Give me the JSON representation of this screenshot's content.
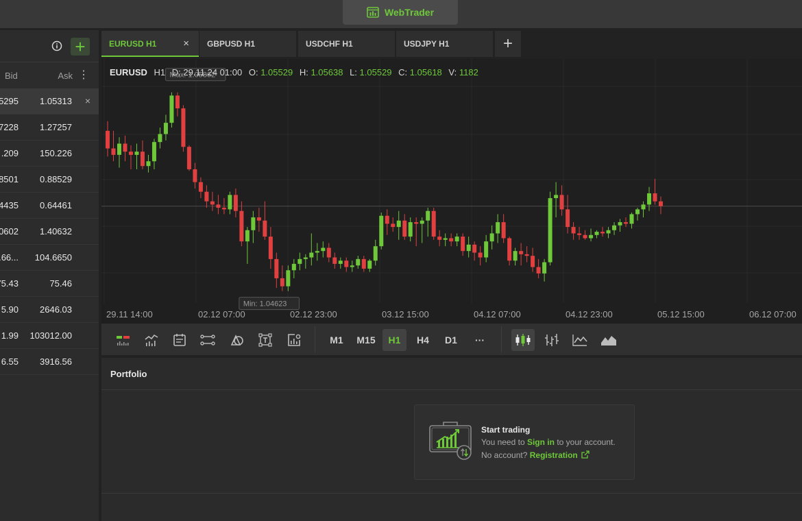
{
  "header": {
    "brand": "WebTrader",
    "brand_icon": "chart-window-icon"
  },
  "watchlist": {
    "bid_header": "Bid",
    "ask_header": "Ask",
    "rows": [
      {
        "bid": "5295",
        "ask": "1.05313",
        "selected": true
      },
      {
        "bid": "7228",
        "ask": "1.27257"
      },
      {
        "bid": ".209",
        "ask": "150.226"
      },
      {
        "bid": "8501",
        "ask": "0.88529"
      },
      {
        "bid": "4435",
        "ask": "0.64461"
      },
      {
        "bid": "0602",
        "ask": "1.40632"
      },
      {
        "bid": ".66...",
        "ask": "104.6650"
      },
      {
        "bid": "75.43",
        "ask": "75.46"
      },
      {
        "bid": "5.90",
        "ask": "2646.03"
      },
      {
        "bid": "1.99",
        "ask": "103012.00"
      },
      {
        "bid": "6.55",
        "ask": "3916.56"
      }
    ]
  },
  "tabs": [
    {
      "label": "EURUSD H1",
      "active": true
    },
    {
      "label": "GBPUSD H1"
    },
    {
      "label": "USDCHF H1"
    },
    {
      "label": "USDJPY H1"
    }
  ],
  "chart_info": {
    "symbol": "EURUSD",
    "timeframe": "H1",
    "d_label": "D:",
    "d_value": "29.11.24 01:00",
    "o_label": "O:",
    "o_value": "1.05529",
    "h_label": "H:",
    "h_value": "1.05638",
    "l_label": "L:",
    "l_value": "1.05529",
    "c_label": "C:",
    "c_value": "1.05618",
    "v_label": "V:",
    "v_value": "1182"
  },
  "chart_data": {
    "type": "candlestick",
    "symbol": "EURUSD",
    "timeframe": "H1",
    "max_label": "Max: 1.05862",
    "min_label": "Min: 1.04623",
    "x_ticks": [
      "29.11 14:00",
      "02.12 07:00",
      "02.12 23:00",
      "03.12 15:00",
      "04.12 07:00",
      "04.12 23:00",
      "05.12 15:00",
      "06.12 07:00"
    ],
    "up_color": "#6ec83a",
    "down_color": "#e04040",
    "candles_ohlc": [
      [
        1.0562,
        1.0568,
        1.0546,
        1.0551
      ],
      [
        1.0551,
        1.0562,
        1.0543,
        1.0547
      ],
      [
        1.0547,
        1.0558,
        1.0539,
        1.0554
      ],
      [
        1.0554,
        1.0559,
        1.0543,
        1.0549
      ],
      [
        1.0549,
        1.0553,
        1.0538,
        1.0547
      ],
      [
        1.0547,
        1.0554,
        1.0538,
        1.0549
      ],
      [
        1.0549,
        1.0556,
        1.0538,
        1.054
      ],
      [
        1.054,
        1.0547,
        1.0536,
        1.0543
      ],
      [
        1.0543,
        1.0557,
        1.0538,
        1.0555
      ],
      [
        1.0555,
        1.0564,
        1.0551,
        1.056
      ],
      [
        1.056,
        1.0572,
        1.0556,
        1.0567
      ],
      [
        1.0567,
        1.0586,
        1.0564,
        1.0584
      ],
      [
        1.0584,
        1.0586,
        1.0571,
        1.0576
      ],
      [
        1.0576,
        1.0578,
        1.0549,
        1.0552
      ],
      [
        1.0552,
        1.0553,
        1.0537,
        1.0538
      ],
      [
        1.0538,
        1.0542,
        1.0526,
        1.053
      ],
      [
        1.053,
        1.0533,
        1.052,
        1.0524
      ],
      [
        1.0524,
        1.0528,
        1.0514,
        1.0518
      ],
      [
        1.0518,
        1.0524,
        1.0512,
        1.0516
      ],
      [
        1.0516,
        1.0522,
        1.051,
        1.0514
      ],
      [
        1.0514,
        1.052,
        1.051,
        1.0513
      ],
      [
        1.0513,
        1.0524,
        1.051,
        1.0522
      ],
      [
        1.0522,
        1.0526,
        1.0508,
        1.0512
      ],
      [
        1.0512,
        1.0518,
        1.049,
        1.0493
      ],
      [
        1.0493,
        1.0502,
        1.0479,
        1.05
      ],
      [
        1.05,
        1.0512,
        1.0492,
        1.0508
      ],
      [
        1.0508,
        1.0514,
        1.0499,
        1.0506
      ],
      [
        1.0506,
        1.0518,
        1.0494,
        1.0496
      ],
      [
        1.0496,
        1.0502,
        1.0476,
        1.0482
      ],
      [
        1.0482,
        1.0486,
        1.0464,
        1.047
      ],
      [
        1.047,
        1.0478,
        1.0462,
        1.0465
      ],
      [
        1.0465,
        1.0478,
        1.0462,
        1.0475
      ],
      [
        1.0475,
        1.0482,
        1.047,
        1.0479
      ],
      [
        1.0479,
        1.0486,
        1.0475,
        1.0482
      ],
      [
        1.0482,
        1.0485,
        1.0476,
        1.0483
      ],
      [
        1.0483,
        1.0498,
        1.0478,
        1.0486
      ],
      [
        1.0486,
        1.0492,
        1.0481,
        1.0487
      ],
      [
        1.0487,
        1.0493,
        1.0483,
        1.0489
      ],
      [
        1.0489,
        1.0492,
        1.048,
        1.0483
      ],
      [
        1.0483,
        1.0486,
        1.0476,
        1.0479
      ],
      [
        1.0479,
        1.0483,
        1.0476,
        1.0481
      ],
      [
        1.0481,
        1.0483,
        1.0474,
        1.0477
      ],
      [
        1.0477,
        1.0481,
        1.0474,
        1.0478
      ],
      [
        1.0478,
        1.0484,
        1.0476,
        1.0482
      ],
      [
        1.0482,
        1.0484,
        1.0474,
        1.0476
      ],
      [
        1.0476,
        1.0482,
        1.0474,
        1.0481
      ],
      [
        1.0481,
        1.0494,
        1.0478,
        1.049
      ],
      [
        1.049,
        1.0511,
        1.0488,
        1.0509
      ],
      [
        1.0509,
        1.0513,
        1.0497,
        1.0504
      ],
      [
        1.0504,
        1.0508,
        1.0499,
        1.0502
      ],
      [
        1.0502,
        1.0512,
        1.0494,
        1.0506
      ],
      [
        1.0506,
        1.051,
        1.0494,
        1.0496
      ],
      [
        1.0496,
        1.0508,
        1.0493,
        1.0505
      ],
      [
        1.0505,
        1.0508,
        1.049,
        1.0504
      ],
      [
        1.0504,
        1.0508,
        1.0492,
        1.0506
      ],
      [
        1.0506,
        1.0514,
        1.0496,
        1.0512
      ],
      [
        1.0512,
        1.0514,
        1.0494,
        1.0496
      ],
      [
        1.0496,
        1.05,
        1.049,
        1.0494
      ],
      [
        1.0494,
        1.0498,
        1.049,
        1.0495
      ],
      [
        1.0495,
        1.0498,
        1.049,
        1.0493
      ],
      [
        1.0493,
        1.0498,
        1.049,
        1.0496
      ],
      [
        1.0496,
        1.0498,
        1.0484,
        1.0487
      ],
      [
        1.0487,
        1.0496,
        1.0483,
        1.0491
      ],
      [
        1.0491,
        1.0493,
        1.0481,
        1.0486
      ],
      [
        1.0486,
        1.049,
        1.0478,
        1.0483
      ],
      [
        1.0483,
        1.0497,
        1.048,
        1.0493
      ],
      [
        1.0493,
        1.0503,
        1.0488,
        1.0498
      ],
      [
        1.0498,
        1.051,
        1.0492,
        1.0505
      ],
      [
        1.0505,
        1.051,
        1.0492,
        1.0495
      ],
      [
        1.0495,
        1.0496,
        1.0478,
        1.0481
      ],
      [
        1.0481,
        1.0489,
        1.0478,
        1.0487
      ],
      [
        1.0487,
        1.0492,
        1.0478,
        1.0485
      ],
      [
        1.0485,
        1.049,
        1.048,
        1.0484
      ],
      [
        1.0484,
        1.0489,
        1.0474,
        1.0477
      ],
      [
        1.0477,
        1.0482,
        1.047,
        1.0473
      ],
      [
        1.0473,
        1.0482,
        1.0468,
        1.048
      ],
      [
        1.048,
        1.0524,
        1.0478,
        1.052
      ],
      [
        1.052,
        1.053,
        1.0508,
        1.0522
      ],
      [
        1.0522,
        1.0528,
        1.0509,
        1.0513
      ],
      [
        1.0513,
        1.0522,
        1.0498,
        1.0502
      ],
      [
        1.0502,
        1.0505,
        1.0494,
        1.0498
      ],
      [
        1.0498,
        1.0502,
        1.0494,
        1.0497
      ],
      [
        1.0497,
        1.05,
        1.0494,
        1.0495
      ],
      [
        1.0495,
        1.0501,
        1.0493,
        1.0497
      ],
      [
        1.0497,
        1.05,
        1.0495,
        1.0499
      ],
      [
        1.0499,
        1.0502,
        1.0496,
        1.0498
      ],
      [
        1.0498,
        1.0502,
        1.0495,
        1.05
      ],
      [
        1.05,
        1.0505,
        1.0497,
        1.0503
      ],
      [
        1.0503,
        1.0507,
        1.0499,
        1.0505
      ],
      [
        1.0505,
        1.0508,
        1.0502,
        1.0504
      ],
      [
        1.0504,
        1.0511,
        1.0501,
        1.051
      ],
      [
        1.051,
        1.0514,
        1.0506,
        1.0513
      ],
      [
        1.0513,
        1.0518,
        1.0508,
        1.0516
      ],
      [
        1.0516,
        1.0527,
        1.0512,
        1.0523
      ],
      [
        1.0523,
        1.0532,
        1.0516,
        1.0518
      ],
      [
        1.0518,
        1.0521,
        1.051,
        1.0515
      ]
    ]
  },
  "toolbar": {
    "timeframes": [
      "M1",
      "M15",
      "H1",
      "H4",
      "D1"
    ],
    "active_timeframe": "H1",
    "more": "···"
  },
  "portfolio": {
    "title": "Portfolio",
    "card_title": "Start trading",
    "line1_pre": "You need to",
    "line1_link": "Sign in",
    "line1_post": "to your account.",
    "line2_pre": "No account?",
    "line2_link": "Registration"
  }
}
